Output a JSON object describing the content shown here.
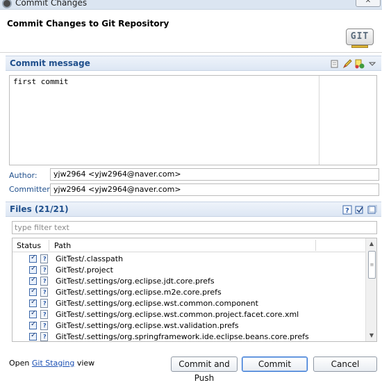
{
  "window": {
    "title": "Commit Changes",
    "close_label": "✕"
  },
  "header": {
    "title": "Commit Changes to Git Repository",
    "logo_text": "GIT"
  },
  "commit_section": {
    "title": "Commit message",
    "message": "first commit",
    "icons": [
      "spell-check-icon",
      "edit-icon",
      "signed-off-icon",
      "dropdown-icon"
    ]
  },
  "author": {
    "label": "Author:",
    "value": "yjw2964 <yjw2964@naver.com>"
  },
  "committer": {
    "label": "Committer:",
    "value": "yjw2964 <yjw2964@naver.com>"
  },
  "files_section": {
    "title": "Files (21/21)",
    "filter_placeholder": "type filter text",
    "columns": {
      "status": "Status",
      "path": "Path"
    },
    "rows": [
      "GitTest/.classpath",
      "GitTest/.project",
      "GitTest/.settings/org.eclipse.jdt.core.prefs",
      "GitTest/.settings/org.eclipse.m2e.core.prefs",
      "GitTest/.settings/org.eclipse.wst.common.component",
      "GitTest/.settings/org.eclipse.wst.common.project.facet.core.xml",
      "GitTest/.settings/org.eclipse.wst.validation.prefs",
      "GitTest/.settings/org.springframework.ide.eclipse.beans.core.prefs"
    ]
  },
  "footer": {
    "open_prefix": "Open",
    "staging_link": "Git Staging",
    "open_suffix": "view",
    "commit_and_push": "Commit and Push",
    "commit": "Commit",
    "cancel": "Cancel"
  }
}
